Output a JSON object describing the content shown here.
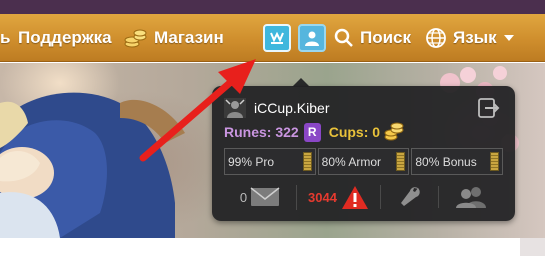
{
  "nav": {
    "support_label": "Поддержка",
    "shop_label": "Магазин",
    "search_label": "Поиск",
    "language_label": "Язык",
    "partial_label": "ь"
  },
  "user_panel": {
    "username": "iCCup.Kiber",
    "runes_label": "Runes: 322",
    "rune_badge": "R",
    "cups_label": "Cups: 0",
    "bars": [
      {
        "label": "99% Pro",
        "value": 0.99
      },
      {
        "label": "80% Armor",
        "value": 0.8
      },
      {
        "label": "80% Bonus",
        "value": 0.8
      }
    ],
    "messages_count": "0",
    "alerts_count": "3044"
  },
  "colors": {
    "nav_gold": "#d49733",
    "panel_bg": "#222224",
    "runes": "#c995e0",
    "cups": "#e9c23a",
    "alert_red": "#e53a2f",
    "arrow_red": "#e8201c",
    "accent_blue": "#3fb7dd"
  },
  "icons": [
    "coins-icon",
    "user-profile-icon",
    "magnifier-icon",
    "globe-icon",
    "chevron-down-icon",
    "logout-icon",
    "envelope-icon",
    "warning-icon",
    "wrench-icon",
    "users-icon",
    "avatar-icon"
  ]
}
